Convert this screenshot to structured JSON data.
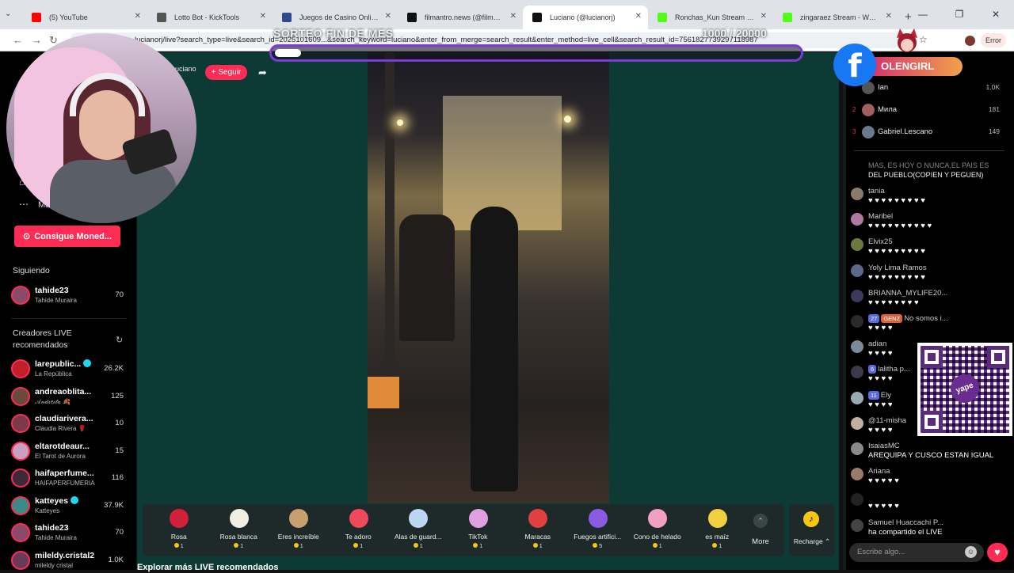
{
  "browser": {
    "tabs": [
      {
        "label": "(5) YouTube",
        "color": "#ff0000",
        "active": false
      },
      {
        "label": "Lotto Bot - KickTools",
        "color": "#555555",
        "active": false
      },
      {
        "label": "Juegos de Casino Online | Apue",
        "color": "#2d4a8a",
        "active": false
      },
      {
        "label": "filmantro.news (@filmantro.ne",
        "color": "#111111",
        "active": false
      },
      {
        "label": "Luciano (@lucianorj)",
        "color": "#111111",
        "active": true
      },
      {
        "label": "Ronchas_Kun Stream - Watch L",
        "color": "#53fc18",
        "active": false
      },
      {
        "label": "zingaraez Stream - Watch Live o",
        "color": "#53fc18",
        "active": false
      }
    ],
    "url": "lucianorj/live?search_type=live&search_id=2025101609...&search_keyword=luciano&enter_from_merge=search_result&enter_method=live_cell&search_result_id=7561827739297118987",
    "error_label": "Error"
  },
  "overlay": {
    "goal_label": "SORTEO FIN DE MES",
    "goal_progress": "1000 / 20000",
    "goal_fraction": 0.05,
    "fb_handle": "OLENGIRL"
  },
  "stream": {
    "host_name": "Luciano",
    "host_sub": "9K",
    "follow_label": "+ Seguir"
  },
  "sidebar": {
    "more_label": "Ma",
    "coins_button": "Consigue Moned...",
    "following_title": "Siguiendo",
    "following": [
      {
        "name": "tahide23",
        "sub": "Tahide Muraira",
        "count": "70",
        "color": "#8a4a6a"
      }
    ],
    "recommended_title": "Creadores LIVE recomendados",
    "recommended": [
      {
        "name": "larepublic...",
        "sub": "La República",
        "count": "26.2K",
        "color": "#c0202a",
        "verified": true
      },
      {
        "name": "andreaoblita...",
        "sub": "𝒜𝓃𝒹𝓇𝑒𝒾𝓉𝒶 🍂",
        "count": "125",
        "color": "#6a4a3a",
        "verified": false
      },
      {
        "name": "claudiarivera...",
        "sub": "Claudia Rivera 🌹",
        "count": "10",
        "color": "#7a3a4a",
        "verified": false
      },
      {
        "name": "eltarotdeaur...",
        "sub": "El Tarot de Aurora",
        "count": "15",
        "color": "#c9a0c0",
        "verified": false
      },
      {
        "name": "haifaperfume...",
        "sub": "HAIFAPERFUMERIA",
        "count": "116",
        "color": "#3a2a3a",
        "verified": false
      },
      {
        "name": "katteyes",
        "sub": "Katteyes",
        "count": "37.9K",
        "color": "#3a8a8a",
        "verified": true
      },
      {
        "name": "tahide23",
        "sub": "Tahide Muraira",
        "count": "70",
        "color": "#8a4a6a",
        "verified": false
      },
      {
        "name": "mileldy.cristal2",
        "sub": "mileldy cristal",
        "count": "1.0K",
        "color": "#6a3a5a",
        "verified": false
      }
    ]
  },
  "gifts": [
    {
      "name": "Rosa",
      "price": "1",
      "color": "#d0203a"
    },
    {
      "name": "Rosa blanca",
      "price": "1",
      "color": "#f0eee0"
    },
    {
      "name": "Eres increíble",
      "price": "1",
      "color": "#c8a070"
    },
    {
      "name": "Te adoro",
      "price": "1",
      "color": "#f04a5a"
    },
    {
      "name": "Alas de guard...",
      "price": "1",
      "color": "#bcd6f0"
    },
    {
      "name": "TikTok",
      "price": "1",
      "color": "#e0a0e0"
    },
    {
      "name": "Maracas",
      "price": "1",
      "color": "#e04040"
    },
    {
      "name": "Fuegos artifici...",
      "price": "5",
      "color": "#8a5ae0"
    },
    {
      "name": "Cono de helado",
      "price": "1",
      "color": "#f0a0c0"
    },
    {
      "name": "es maíz",
      "price": "1",
      "color": "#f0d040"
    }
  ],
  "gift_more": "More",
  "recharge_label": "Recharge",
  "below_title": "Explorar más LIVE recomendados",
  "chat": {
    "ranking": [
      {
        "rank": "",
        "name": "Ian",
        "value": "1.0K",
        "color": "#555555"
      },
      {
        "rank": "2",
        "name": "Мила",
        "value": "181",
        "color": "#a06060"
      },
      {
        "rank": "3",
        "name": "Gabriel.Lescano",
        "value": "149",
        "color": "#6a7a8a"
      }
    ],
    "top_message_dim": "MAS, ES HOY O NUNCA,EL PAIS ES",
    "top_message": "DEL PUEBLO(COPIEN Y PEGUEN)",
    "messages": [
      {
        "user": "tania",
        "text": "♥ ♥ ♥ ♥ ♥ ♥ ♥ ♥ ♥",
        "color": "#8a7a6a"
      },
      {
        "user": "Maribel",
        "text": "♥ ♥ ♥ ♥ ♥ ♥ ♥ ♥ ♥ ♥",
        "color": "#b07aa0"
      },
      {
        "user": "Elvix25",
        "text": "♥ ♥ ♥ ♥ ♥ ♥ ♥ ♥ ♥",
        "color": "#6a7a3a"
      },
      {
        "user": "Yoly Lima Ramos",
        "text": "♥ ♥ ♥ ♥ ♥ ♥ ♥ ♥ ♥",
        "color": "#5a6a8a"
      },
      {
        "user": "BRIANNA_MYLIFE20...",
        "text": "♥ ♥ ♥ ♥ ♥ ♥ ♥ ♥",
        "color": "#3a3a5a"
      },
      {
        "user": "No somos i...",
        "text": "♥ ♥ ♥ ♥",
        "color": "#2a2a2a",
        "badges": [
          "27",
          "GENZ"
        ]
      },
      {
        "user": "adian",
        "text": "♥ ♥ ♥ ♥",
        "color": "#7a8a9a"
      },
      {
        "user": "lalitha p...",
        "text": "♥ ♥ ♥ ♥",
        "color": "#3a3a4a",
        "badges": [
          "6"
        ]
      },
      {
        "user": "Ely",
        "text": "♥ ♥ ♥ ♥",
        "color": "#9aaab0",
        "badges": [
          "11"
        ]
      },
      {
        "user": "@11-misha",
        "text": "♥ ♥ ♥ ♥",
        "color": "#c0b0a0"
      },
      {
        "user": "IsaiasMC",
        "text": "AREQUIPA Y CUSCO ESTAN IGUAL",
        "color": "#8a8a8a"
      },
      {
        "user": "Ariana",
        "text": "♥ ♥ ♥ ♥ ♥",
        "color": "#9a7a6a"
      },
      {
        "user": "",
        "text": "♥ ♥ ♥ ♥ ♥",
        "color": "#222222"
      },
      {
        "user": "Samuel Huaccachi P...",
        "text": "ha compartido el LIVE",
        "color": "#444444"
      }
    ],
    "input_placeholder": "Escribe algo..."
  }
}
